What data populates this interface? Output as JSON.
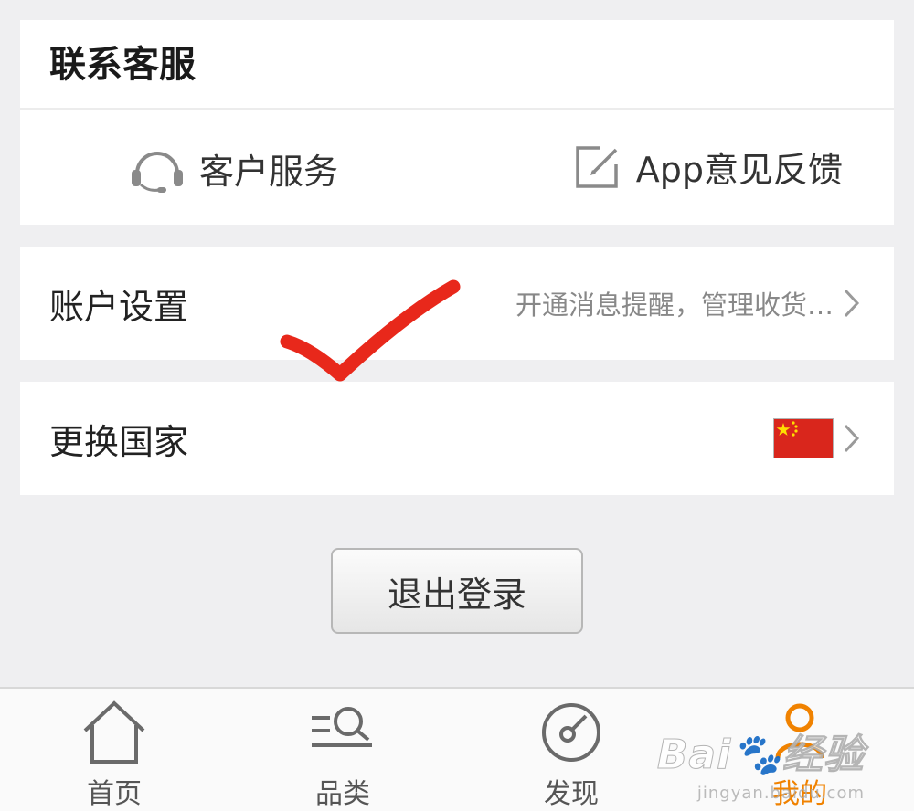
{
  "contact": {
    "title": "联系客服",
    "customer_service_label": "客户服务",
    "customer_service_icon": "headset-icon",
    "feedback_label": "App意见反馈",
    "feedback_icon": "edit-icon"
  },
  "account_settings": {
    "label": "账户设置",
    "hint": "开通消息提醒，管理收货…"
  },
  "change_country": {
    "label": "更换国家",
    "flag": "china-flag-icon"
  },
  "logout_label": "退出登录",
  "tabbar": {
    "tabs": [
      {
        "label": "首页",
        "icon": "home-icon"
      },
      {
        "label": "品类",
        "icon": "category-search-icon"
      },
      {
        "label": "发现",
        "icon": "discover-icon"
      },
      {
        "label": "我的",
        "icon": "user-icon",
        "active": true
      }
    ]
  },
  "watermark": {
    "brand": "Bai",
    "brand_cn": "经验",
    "site": "jingyan.baidu.com"
  },
  "colors": {
    "accent": "#f08200",
    "annotation": "#e8281b",
    "background": "#efeff1"
  }
}
